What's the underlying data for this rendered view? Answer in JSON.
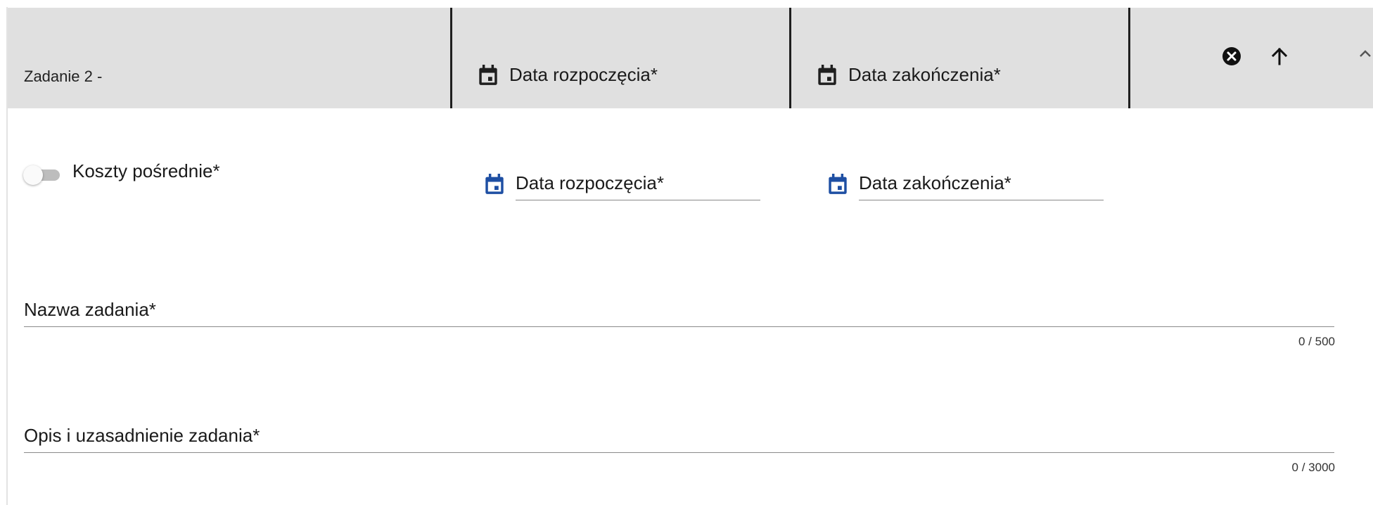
{
  "header": {
    "task_title": "Zadanie 2 -",
    "start_date_label": "Data rozpoczęcia*",
    "end_date_label": "Data zakończenia*",
    "remove_icon": "close-circle-icon",
    "move_up_icon": "arrow-up-icon",
    "collapse_icon": "chevron-up-icon"
  },
  "form": {
    "indirect_costs": {
      "label": "Koszty pośrednie*",
      "checked": false
    },
    "start_date": {
      "placeholder": "Data rozpoczęcia*",
      "icon": "calendar-icon"
    },
    "end_date": {
      "placeholder": "Data zakończenia*",
      "icon": "calendar-icon"
    },
    "task_name": {
      "placeholder": "Nazwa zadania*",
      "counter": "0 / 500"
    },
    "task_description": {
      "placeholder": "Opis i uzasadnienie zadania*",
      "counter": "0 / 3000"
    }
  },
  "colors": {
    "header_bg": "#e0e0e0",
    "calendar_accent": "#1e4fa3",
    "header_icon": "#1f1f1f"
  }
}
